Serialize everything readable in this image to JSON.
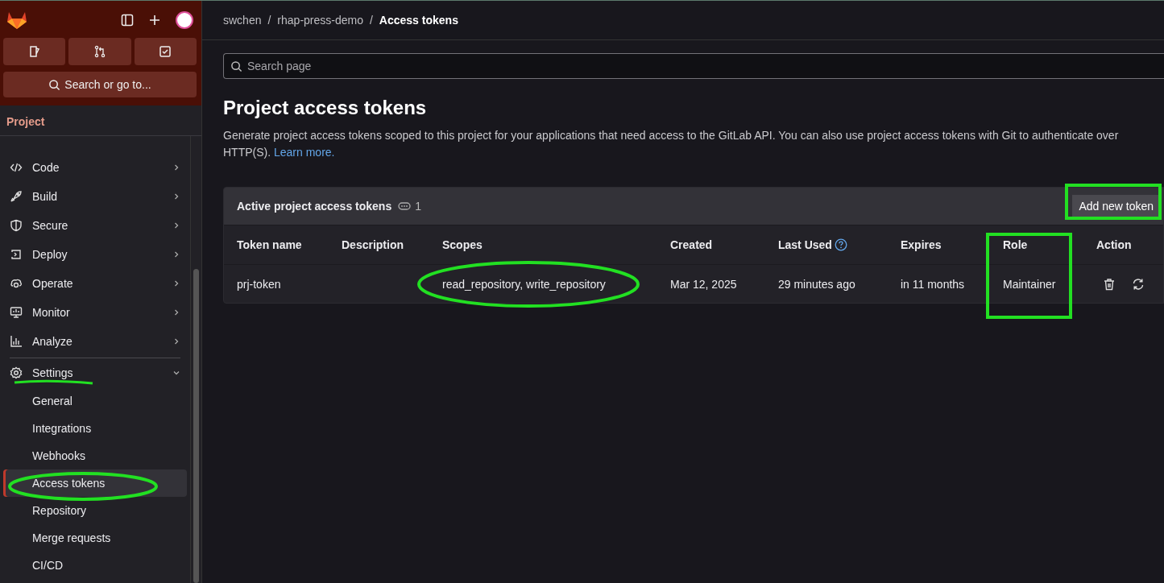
{
  "sidebar": {
    "search_button": "Search or go to...",
    "section_title": "Project",
    "items": [
      {
        "label": "Code",
        "kind": "code",
        "expanded": false
      },
      {
        "label": "Build",
        "kind": "build",
        "expanded": false
      },
      {
        "label": "Secure",
        "kind": "secure",
        "expanded": false
      },
      {
        "label": "Deploy",
        "kind": "deploy",
        "expanded": false
      },
      {
        "label": "Operate",
        "kind": "operate",
        "expanded": false
      },
      {
        "label": "Monitor",
        "kind": "monitor",
        "expanded": false
      },
      {
        "label": "Analyze",
        "kind": "analyze",
        "expanded": false
      },
      {
        "label": "Settings",
        "kind": "settings",
        "expanded": true,
        "children": [
          {
            "label": "General",
            "selected": false
          },
          {
            "label": "Integrations",
            "selected": false
          },
          {
            "label": "Webhooks",
            "selected": false
          },
          {
            "label": "Access tokens",
            "selected": true
          },
          {
            "label": "Repository",
            "selected": false
          },
          {
            "label": "Merge requests",
            "selected": false
          },
          {
            "label": "CI/CD",
            "selected": false
          }
        ]
      }
    ]
  },
  "breadcrumb": {
    "separator": "/",
    "items": [
      {
        "label": "swchen",
        "current": false
      },
      {
        "label": "rhap-press-demo",
        "current": false
      },
      {
        "label": "Access tokens",
        "current": true
      }
    ]
  },
  "search": {
    "placeholder": "Search page"
  },
  "title": "Project access tokens",
  "description": "Generate project access tokens scoped to this project for your applications that need access to the GitLab API. You can also use project access tokens with Git to authenticate over HTTP(S).",
  "learn_more_link": "Learn more.",
  "card": {
    "title": "Active project access tokens",
    "count": "1",
    "add_button": "Add new token",
    "columns": [
      "Token name",
      "Description",
      "Scopes",
      "Created",
      "Last Used",
      "Expires",
      "Role",
      "Action"
    ],
    "rows": [
      {
        "token_name": "prj-token",
        "scopes": "read_repository, write_repository",
        "created": "Mar 12, 2025",
        "last_used": "29 minutes ago",
        "expires": "in 11 months",
        "role": "Maintainer"
      }
    ]
  }
}
